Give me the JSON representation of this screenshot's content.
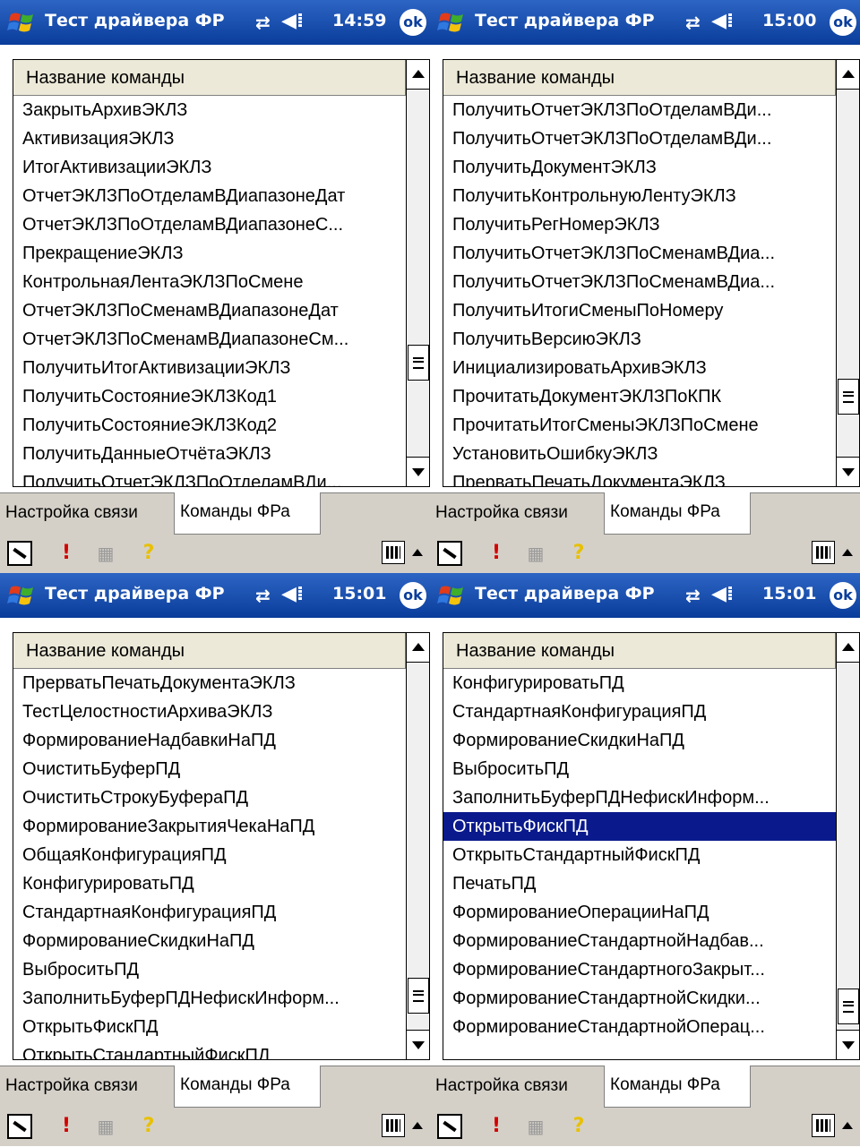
{
  "app_title": "Тест драйвера ФР",
  "column_header": "Название команды",
  "tabs": [
    "Настройка связи",
    "Команды ФРа"
  ],
  "ok_label": "ok",
  "colors": {
    "title_bar": "#0a3d9b",
    "selection": "#0a1a8c",
    "alert": "#d40000"
  },
  "icons": [
    "windows-start-icon",
    "connectivity-icon",
    "speaker-icon",
    "ok-icon",
    "tool-icon",
    "alert-icon",
    "network-icon",
    "help-icon",
    "keyboard-icon",
    "sip-up-icon"
  ],
  "panels": [
    {
      "clock": "14:59",
      "rows": [
        "ЗакрытьАрхивЭКЛЗ",
        "АктивизацияЭКЛЗ",
        "ИтогАктивизацииЭКЛЗ",
        "ОтчетЭКЛЗПоОтделамВДиапазонеДат",
        "ОтчетЭКЛЗПоОтделамВДиапазонеС...",
        "ПрекращениеЭКЛЗ",
        "КонтрольнаяЛентаЭКЛЗПоСмене",
        "ОтчетЭКЛЗПоСменамВДиапазонеДат",
        "ОтчетЭКЛЗПоСменамВДиапазонеСм...",
        "ПолучитьИтогАктивизацииЭКЛЗ",
        "ПолучитьСостояниеЭКЛЗКод1",
        "ПолучитьСостояниеЭКЛЗКод2",
        "ПолучитьДанныеОтчётаЭКЛЗ",
        "ПолучитьОтчетЭКЛЗПоОтделамВДи..."
      ],
      "selected": -1,
      "scroll_position": 0.77
    },
    {
      "clock": "15:00",
      "rows": [
        "ПолучитьОтчетЭКЛЗПоОтделамВДи...",
        "ПолучитьОтчетЭКЛЗПоОтделамВДи...",
        "ПолучитьДокументЭКЛЗ",
        "ПолучитьКонтрольнуюЛентуЭКЛЗ",
        "ПолучитьРегНомерЭКЛЗ",
        "ПолучитьОтчетЭКЛЗПоСменамВДиа...",
        "ПолучитьОтчетЭКЛЗПоСменамВДиа...",
        "ПолучитьИтогиСменыПоНомеру",
        "ПолучитьВерсиюЭКЛЗ",
        "ИнициализироватьАрхивЭКЛЗ",
        "ПрочитатьДокументЭКЛЗПоКПК",
        "ПрочитатьИтогСменыЭКЛЗПоСмене",
        "УстановитьОшибкуЭКЛЗ",
        "ПрерватьПечатьДокументаЭКЛЗ"
      ],
      "selected": -1,
      "scroll_position": 0.87
    },
    {
      "clock": "15:01",
      "rows": [
        "ПрерватьПечатьДокументаЭКЛЗ",
        "ТестЦелостностиАрхиваЭКЛЗ",
        "ФормированиеНадбавкиНаПД",
        "ОчиститьБуферПД",
        "ОчиститьСтрокуБуфераПД",
        "ФормированиеЗакрытияЧекаНаПД",
        "ОбщаяКонфигурацияПД",
        "КонфигурироватьПД",
        "СтандартнаяКонфигурацияПД",
        "ФормированиеСкидкиНаПД",
        "ВыброситьПД",
        "ЗаполнитьБуферПДНефискИнформ...",
        "ОткрытьФискПД",
        "ОткрытьСтандартныйФискПД"
      ],
      "selected": -1,
      "scroll_position": 0.95
    },
    {
      "clock": "15:01",
      "rows": [
        "КонфигурироватьПД",
        "СтандартнаяКонфигурацияПД",
        "ФормированиеСкидкиНаПД",
        "ВыброситьПД",
        "ЗаполнитьБуферПДНефискИнформ...",
        "ОткрытьФискПД",
        "ОткрытьСтандартныйФискПД",
        "ПечатьПД",
        "ФормированиеОперацииНаПД",
        "ФормированиеСтандартнойНадбав...",
        "ФормированиеСтандартногоЗакрыт...",
        "ФормированиеСтандартнойСкидки...",
        "ФормированиеСтандартнойОперац..."
      ],
      "selected": 5,
      "scroll_position": 0.98
    }
  ]
}
